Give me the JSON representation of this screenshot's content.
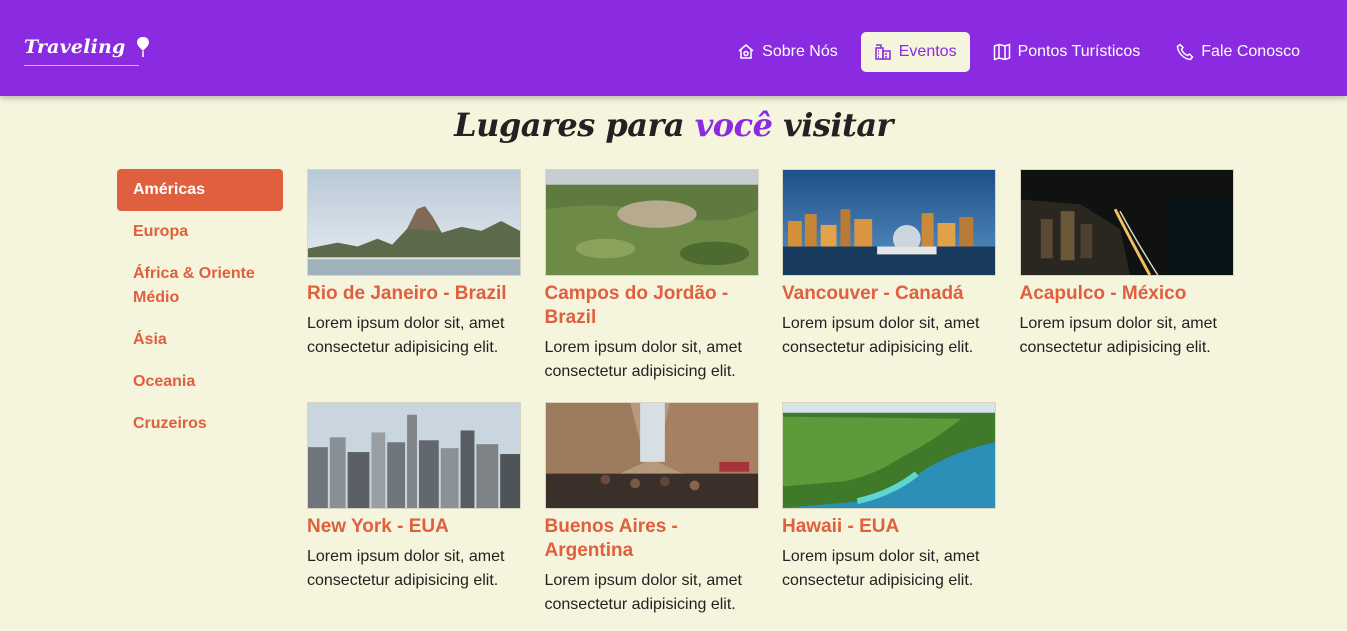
{
  "header": {
    "brand": "Traveling",
    "colors": {
      "bar": "#8a2be2",
      "accent": "#e05f3e",
      "background": "#f5f4dc"
    },
    "nav": [
      {
        "label": "Sobre Nós",
        "icon": "home-icon"
      },
      {
        "label": "Eventos",
        "icon": "buildings-icon",
        "active": true
      },
      {
        "label": "Pontos Turísticos",
        "icon": "map-icon"
      },
      {
        "label": "Fale Conosco",
        "icon": "phone-icon"
      }
    ]
  },
  "heading": {
    "before": "Lugares para ",
    "highlight": "você",
    "after": " visitar"
  },
  "sidebar": {
    "items": [
      {
        "label": "Américas",
        "active": true
      },
      {
        "label": "Europa"
      },
      {
        "label": "África & Oriente Médio"
      },
      {
        "label": "Ásia"
      },
      {
        "label": "Oceania"
      },
      {
        "label": "Cruzeiros"
      }
    ]
  },
  "cards": [
    {
      "title": "Rio de Janeiro - Brazil",
      "desc": "Lorem ipsum dolor sit, amet consectetur adipisicing elit.",
      "image": "rio-photo"
    },
    {
      "title": "Campos do Jordão - Brazil",
      "desc": "Lorem ipsum dolor sit, amet consectetur adipisicing elit.",
      "image": "campos-photo"
    },
    {
      "title": "Vancouver - Canadá",
      "desc": "Lorem ipsum dolor sit, amet consectetur adipisicing elit.",
      "image": "vancouver-photo"
    },
    {
      "title": "Acapulco - México",
      "desc": "Lorem ipsum dolor sit, amet consectetur adipisicing elit.",
      "image": "acapulco-photo"
    },
    {
      "title": "New York - EUA",
      "desc": "Lorem ipsum dolor sit, amet consectetur adipisicing elit.",
      "image": "newyork-photo"
    },
    {
      "title": "Buenos Aires - Argentina",
      "desc": "Lorem ipsum dolor sit, amet consectetur adipisicing elit.",
      "image": "buenosaires-photo"
    },
    {
      "title": "Hawaii - EUA",
      "desc": "Lorem ipsum dolor sit, amet consectetur adipisicing elit.",
      "image": "hawaii-photo"
    }
  ]
}
